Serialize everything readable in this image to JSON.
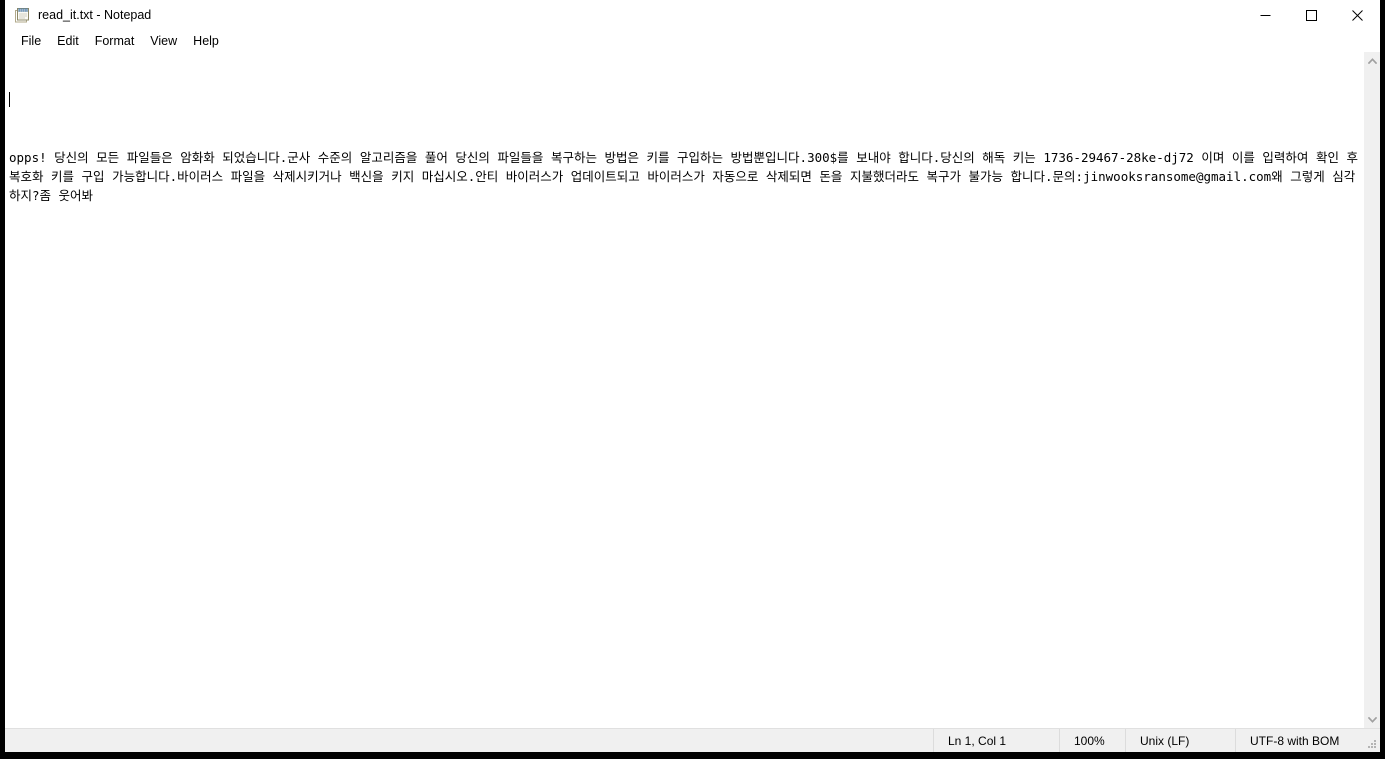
{
  "window": {
    "title": "read_it.txt - Notepad",
    "icon": "notepad-icon",
    "controls": {
      "minimize": "minimize-icon",
      "maximize": "maximize-icon",
      "close": "close-icon"
    }
  },
  "menubar": {
    "items": [
      {
        "label": "File"
      },
      {
        "label": "Edit"
      },
      {
        "label": "Format"
      },
      {
        "label": "View"
      },
      {
        "label": "Help"
      }
    ]
  },
  "document": {
    "lines": [
      "",
      "opps! 당신의 모든 파일들은 암화화 되었습니다.군사 수준의 알고리즘을 풀어 당신의 파일들을 복구하는 방법은 키를 구입하는 방법뿐입니다.300$를 보내야 합니다.당신의 해독 키는 1736-29467-28ke-dj72 이며 이를 입력하여 확인 후 복호화 키를 구입 가능합니다.바이러스 파일을 삭제시키거나 백신을 키지 마십시오.안티 바이러스가 업데이트되고 바이러스가 자동으로 삭제되면 돈을 지불했더라도 복구가 불가능 합니다.문의:jinwooksransome@gmail.com왜 그렇게 심각하지?좀 웃어봐"
    ],
    "caret_visible": true,
    "ransom_details": {
      "greeting": "opps!",
      "amount": "300$",
      "decryption_key": "1736-29467-28ke-dj72",
      "contact_email": "jinwooksransome@gmail.com"
    }
  },
  "scrollbar": {
    "up_arrow": "chevron-up-icon",
    "down_arrow": "chevron-down-icon"
  },
  "statusbar": {
    "position": "Ln 1, Col 1",
    "zoom": "100%",
    "line_ending": "Unix (LF)",
    "encoding": "UTF-8 with BOM",
    "grip": "resize-grip-icon"
  },
  "colors": {
    "window_bg": "#ffffff",
    "statusbar_bg": "#f0f0f0",
    "scrollbar_bg": "#f0f0f0",
    "text": "#000000",
    "screenshot_border": "#000000"
  }
}
